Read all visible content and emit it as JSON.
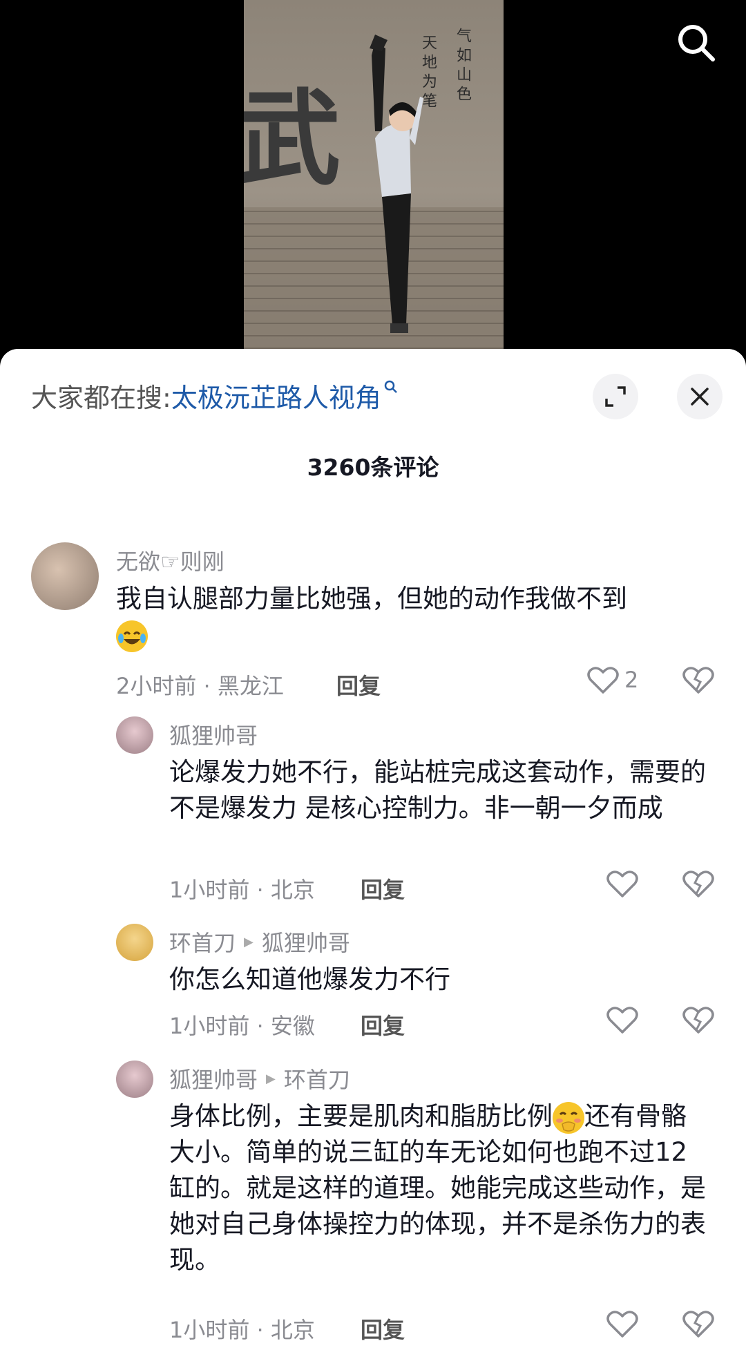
{
  "video": {
    "calligraphy_left": "天地为笔",
    "calligraphy_right": "气如山色",
    "wall_char": "武"
  },
  "sheet": {
    "hot_search_prefix": "大家都在搜:",
    "hot_search_keyword": "太极沅芷路人视角",
    "comment_count": "3260条评论"
  },
  "comments": [
    {
      "user": "无欲☞则刚",
      "text": "我自认腿部力量比她强，但她的动作我做不到",
      "meta": "2小时前 · 黑龙江",
      "reply": "回复",
      "likes": "2"
    },
    {
      "user": "狐狸帅哥",
      "text": "论爆发力她不行，能站桩完成这套动作，需要的不是爆发力 是核心控制力。非一朝一夕而成",
      "meta": "1小时前 · 北京",
      "reply": "回复"
    },
    {
      "user": "环首刀",
      "reply_to": "狐狸帅哥",
      "text": "你怎么知道他爆发力不行",
      "meta": "1小时前 · 安徽",
      "reply": "回复"
    },
    {
      "user": "狐狸帅哥",
      "reply_to": "环首刀",
      "text_a": "身体比例，主要是肌肉和脂肪比例",
      "text_b": "还有骨骼大小。简单的说三缸的车无论如何也跑不过12缸的。就是这样的道理。她能完成这些动作，是她对自己身体操控力的体现，并不是杀伤力的表现。",
      "meta": "1小时前 · 北京",
      "reply": "回复"
    }
  ]
}
